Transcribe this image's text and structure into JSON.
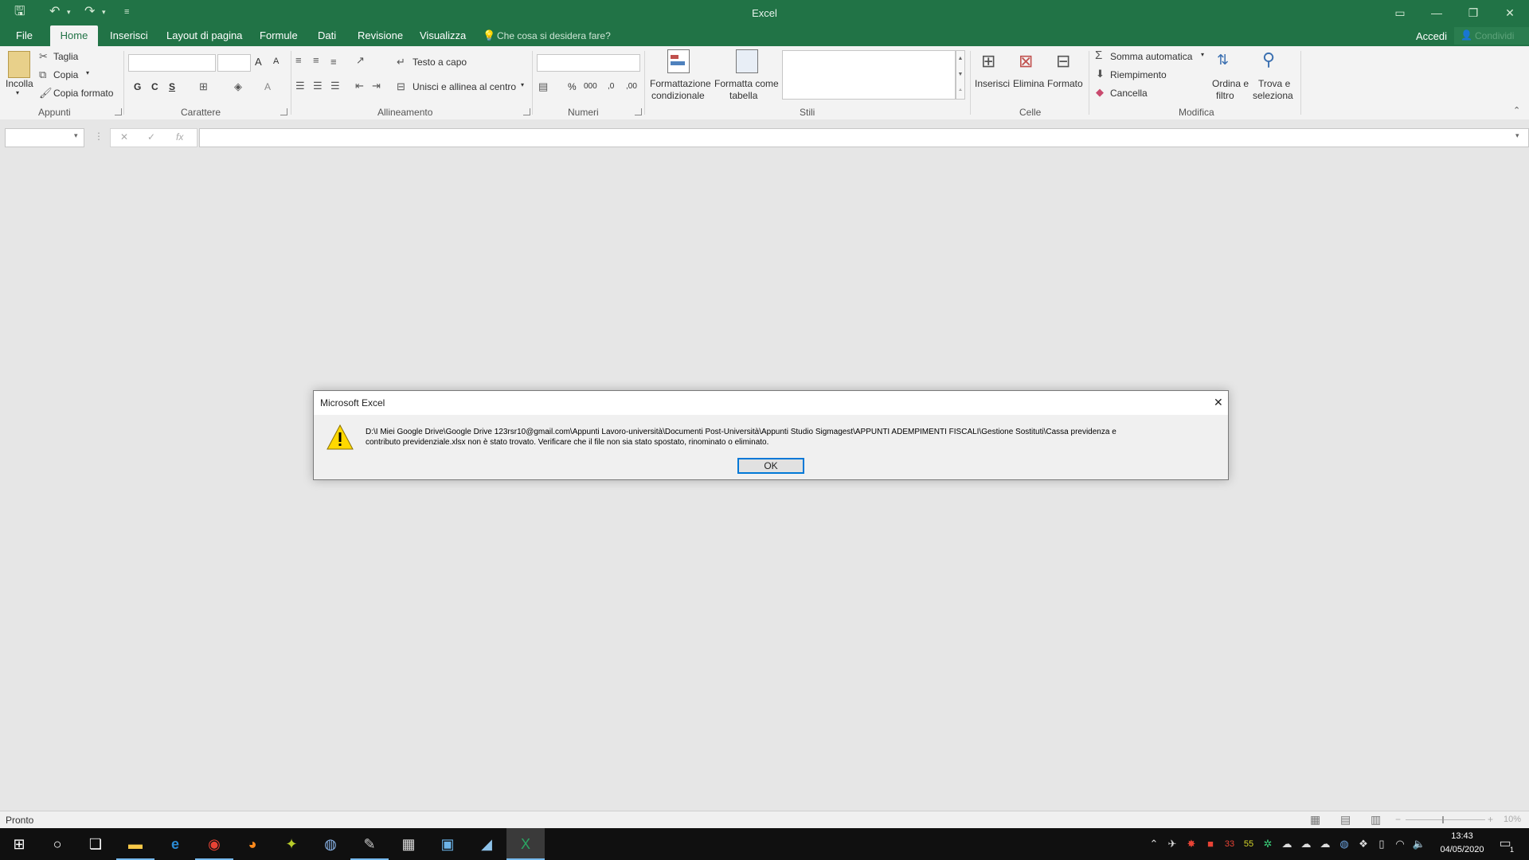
{
  "app": {
    "title": "Excel",
    "accent": "#217346"
  },
  "quick_access": {
    "save_icon": "save-icon",
    "undo_icon": "undo-icon",
    "redo_icon": "redo-icon",
    "customize_icon": "customize-icon"
  },
  "tabs": [
    {
      "label": "File"
    },
    {
      "label": "Home"
    },
    {
      "label": "Inserisci"
    },
    {
      "label": "Layout di pagina"
    },
    {
      "label": "Formule"
    },
    {
      "label": "Dati"
    },
    {
      "label": "Revisione"
    },
    {
      "label": "Visualizza"
    }
  ],
  "tell_me": "Che cosa si desidera fare?",
  "account": {
    "signin": "Accedi",
    "share": "Condividi"
  },
  "ribbon": {
    "clipboard": {
      "paste": "Incolla",
      "cut": "Taglia",
      "copy": "Copia",
      "format_painter": "Copia formato",
      "group": "Appunti"
    },
    "font": {
      "bold": "G",
      "italic": "C",
      "underline": "S",
      "grow": "A",
      "shrink": "A",
      "color": "A",
      "group": "Carattere"
    },
    "alignment": {
      "wrap": "Testo a capo",
      "merge": "Unisci e allinea al centro",
      "group": "Allineamento"
    },
    "number": {
      "percent": "%",
      "thousands": "000",
      "inc_dec": ",0",
      "dec_dec": ",00",
      "group": "Numeri"
    },
    "styles": {
      "conditional": "Formattazione",
      "conditional2": "condizionale",
      "as_table": "Formatta come",
      "as_table2": "tabella",
      "group": "Stili"
    },
    "cells": {
      "insert": "Inserisci",
      "delete": "Elimina",
      "format": "Formato",
      "group": "Celle"
    },
    "editing": {
      "autosum": "Somma automatica",
      "fill": "Riempimento",
      "clear": "Cancella",
      "sort": "Ordina e",
      "sort2": "filtro",
      "find": "Trova e",
      "find2": "seleziona",
      "group": "Modifica"
    }
  },
  "formula_bar": {
    "cancel": "✕",
    "enter": "✓",
    "fx": "fx"
  },
  "dialog": {
    "title": "Microsoft Excel",
    "line1": "D:\\I Miei Google Drive\\Google Drive 123rsr10@gmail.com\\Appunti Lavoro-università\\Documenti Post-Università\\Appunti Studio Sigmagest\\APPUNTI ADEMPIMENTI FISCALI\\Gestione Sostituti\\Cassa previdenza e",
    "line2": "contributo previdenziale.xlsx non è stato trovato. Verificare che il file non sia stato spostato, rinominato o eliminato.",
    "ok": "OK"
  },
  "status": {
    "ready": "Pronto",
    "zoom": "10%"
  },
  "taskbar": {
    "tray_num1": "33",
    "tray_num2": "55",
    "time": "13:43",
    "date": "04/05/2020",
    "notif_count": "1"
  }
}
